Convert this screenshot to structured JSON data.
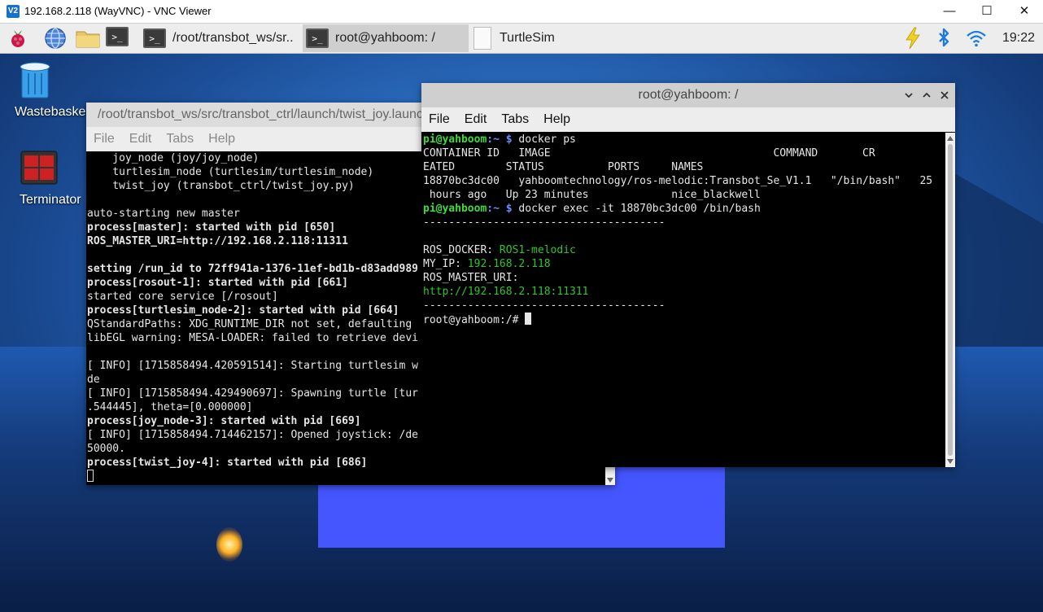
{
  "vnc": {
    "title": "192.168.2.118 (WayVNC) - VNC Viewer",
    "logo": "V2",
    "minimize": "—",
    "maximize": "☐",
    "close": "✕"
  },
  "panel": {
    "tasks": [
      {
        "label": "/root/transbot_ws/sr.."
      },
      {
        "label": "root@yahboom: /"
      },
      {
        "label": "TurtleSim"
      }
    ],
    "terminal_glyph": ">_",
    "clock": "19:22"
  },
  "desktop": {
    "icons": [
      {
        "label": "Wastebasket"
      },
      {
        "label": "Terminator"
      }
    ]
  },
  "terminal_back": {
    "title": "/root/transbot_ws/src/transbot_ctrl/launch/twist_joy.launch",
    "menu": [
      "File",
      "Edit",
      "Tabs",
      "Help"
    ],
    "lines": [
      "    joy_node (joy/joy_node)",
      "    turtlesim_node (turtlesim/turtlesim_node)",
      "    twist_joy (transbot_ctrl/twist_joy.py)",
      "",
      "auto-starting new master",
      "process[master]: started with pid [650]",
      "ROS_MASTER_URI=http://192.168.2.118:11311",
      "",
      "setting /run_id to 72ff941a-1376-11ef-bd1b-d83add989",
      "process[rosout-1]: started with pid [661]",
      "started core service [/rosout]",
      "process[turtlesim_node-2]: started with pid [664]",
      "QStandardPaths: XDG_RUNTIME_DIR not set, defaulting",
      "libEGL warning: MESA-LOADER: failed to retrieve devi",
      "",
      "[ INFO] [1715858494.420591514]: Starting turtlesim w",
      "de",
      "[ INFO] [1715858494.429490697]: Spawning turtle [tur",
      ".544445], theta=[0.000000]",
      "process[joy_node-3]: started with pid [669]",
      "[ INFO] [1715858494.714462157]: Opened joystick: /de",
      "50000.",
      "process[twist_joy-4]: started with pid [686]"
    ]
  },
  "terminal_front": {
    "title": "root@yahboom: /",
    "menu": [
      "File",
      "Edit",
      "Tabs",
      "Help"
    ],
    "prompt_user": "pi@yahboom",
    "prompt_path": ":~ $",
    "cmd1": " docker ps",
    "header1": "CONTAINER ID   IMAGE                                   COMMAND       CR",
    "header2": "EATED        STATUS          PORTS     NAMES",
    "row1": "18870bc3dc00   yahboomtechnology/ros-melodic:Transbot_Se_V1.1   \"/bin/bash\"   25",
    "row2": " hours ago   Up 23 minutes             nice_blackwell",
    "cmd2": " docker exec -it 18870bc3dc00 /bin/bash",
    "divider": "--------------------------------------",
    "ros_docker_label": "ROS_DOCKER: ",
    "ros_docker_value": "ROS1-melodic",
    "my_ip_label": "MY_IP: ",
    "my_ip_value": "192.168.2.118",
    "ros_master_label": "ROS_MASTER_URI:",
    "ros_master_value": "http://192.168.2.118:11311",
    "root_prompt": "root@yahboom:/# "
  },
  "colors": {
    "prompt_green": "#3ddc3d",
    "prompt_blue": "#6b8cff",
    "value_green": "#2fc42f",
    "turtlesim_bg": "#4556ff"
  }
}
